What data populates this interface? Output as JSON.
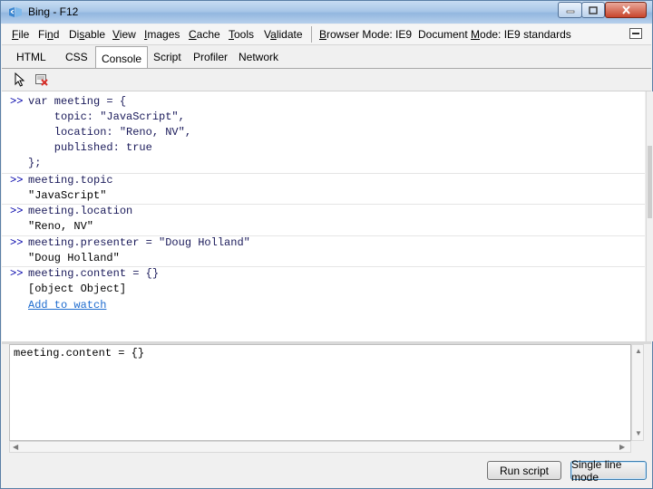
{
  "window": {
    "title": "Bing - F12"
  },
  "menubar": {
    "items": [
      {
        "prefix": "",
        "mnemonic": "F",
        "suffix": "ile"
      },
      {
        "prefix": "Fi",
        "mnemonic": "n",
        "suffix": "d"
      },
      {
        "prefix": "Di",
        "mnemonic": "s",
        "suffix": "able"
      },
      {
        "prefix": "",
        "mnemonic": "V",
        "suffix": "iew"
      },
      {
        "prefix": "",
        "mnemonic": "I",
        "suffix": "mages"
      },
      {
        "prefix": "",
        "mnemonic": "C",
        "suffix": "ache"
      },
      {
        "prefix": "",
        "mnemonic": "T",
        "suffix": "ools"
      },
      {
        "prefix": "V",
        "mnemonic": "a",
        "suffix": "lidate"
      },
      {
        "prefix": "",
        "mnemonic": "B",
        "suffix": "rowser Mode: IE9"
      },
      {
        "prefix": "Document ",
        "mnemonic": "M",
        "suffix": "ode: IE9 standards"
      }
    ]
  },
  "tabs": [
    "HTML",
    "CSS",
    "Console",
    "Script",
    "Profiler",
    "Network"
  ],
  "active_tab": "Console",
  "toolbar": {
    "icons": [
      "select-element-icon",
      "clear-console-icon"
    ]
  },
  "console": {
    "prompt": ">>",
    "entries": [
      {
        "input": [
          "var meeting = {",
          "    topic: \"JavaScript\",",
          "    location: \"Reno, NV\",",
          "    published: true",
          "};"
        ],
        "output": []
      },
      {
        "input": [
          "meeting.topic"
        ],
        "output": [
          "\"JavaScript\""
        ]
      },
      {
        "input": [
          "meeting.location"
        ],
        "output": [
          "\"Reno, NV\""
        ]
      },
      {
        "input": [
          "meeting.presenter = \"Doug Holland\""
        ],
        "output": [
          "\"Doug Holland\""
        ]
      },
      {
        "input": [
          "meeting.content = {}"
        ],
        "output": [
          "[object Object]"
        ],
        "link": "Add to watch"
      }
    ]
  },
  "input_area": {
    "value": "meeting.content = {}"
  },
  "buttons": {
    "run": "Run script",
    "single_line": "Single line mode"
  }
}
